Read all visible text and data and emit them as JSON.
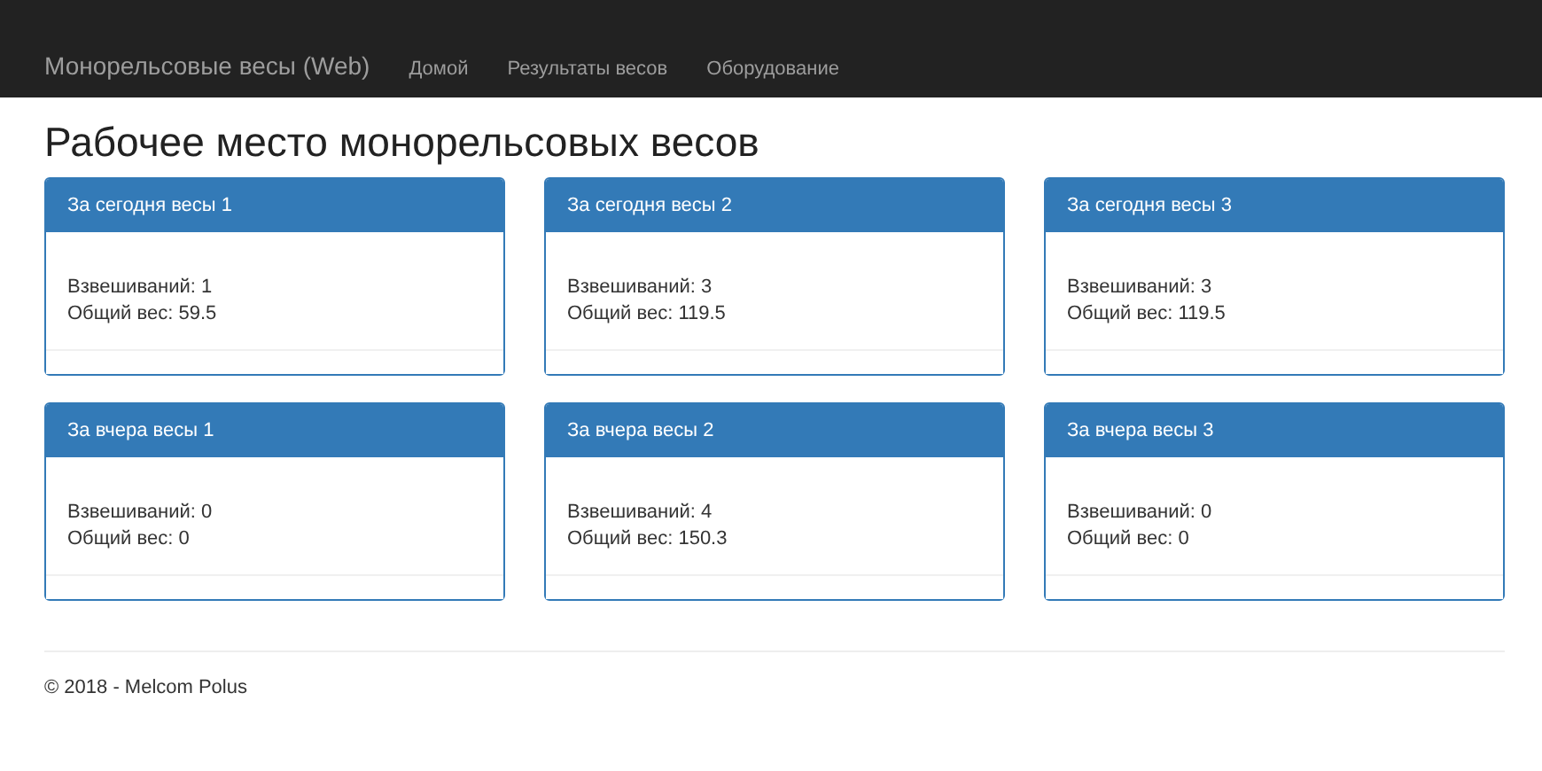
{
  "navbar": {
    "brand": "Монорельсовые весы (Web)",
    "links": [
      {
        "label": "Домой"
      },
      {
        "label": "Результаты весов"
      },
      {
        "label": "Оборудование"
      }
    ]
  },
  "page_title": "Рабочее место монорельсовых весов",
  "panels": [
    {
      "title": "За сегодня весы 1",
      "lines": [
        "Взвешиваний: 1",
        "Общий вес: 59.5"
      ]
    },
    {
      "title": "За сегодня весы 2",
      "lines": [
        "Взвешиваний: 3",
        "Общий вес: 119.5"
      ]
    },
    {
      "title": "За сегодня весы 3",
      "lines": [
        "Взвешиваний: 3",
        "Общий вес: 119.5"
      ]
    },
    {
      "title": "За вчера весы 1",
      "lines": [
        "Взвешиваний: 0",
        "Общий вес: 0"
      ]
    },
    {
      "title": "За вчера весы 2",
      "lines": [
        "Взвешиваний: 4",
        "Общий вес: 150.3"
      ]
    },
    {
      "title": "За вчера весы 3",
      "lines": [
        "Взвешиваний: 0",
        "Общий вес: 0"
      ]
    }
  ],
  "footer": "© 2018 - Melcom Polus"
}
